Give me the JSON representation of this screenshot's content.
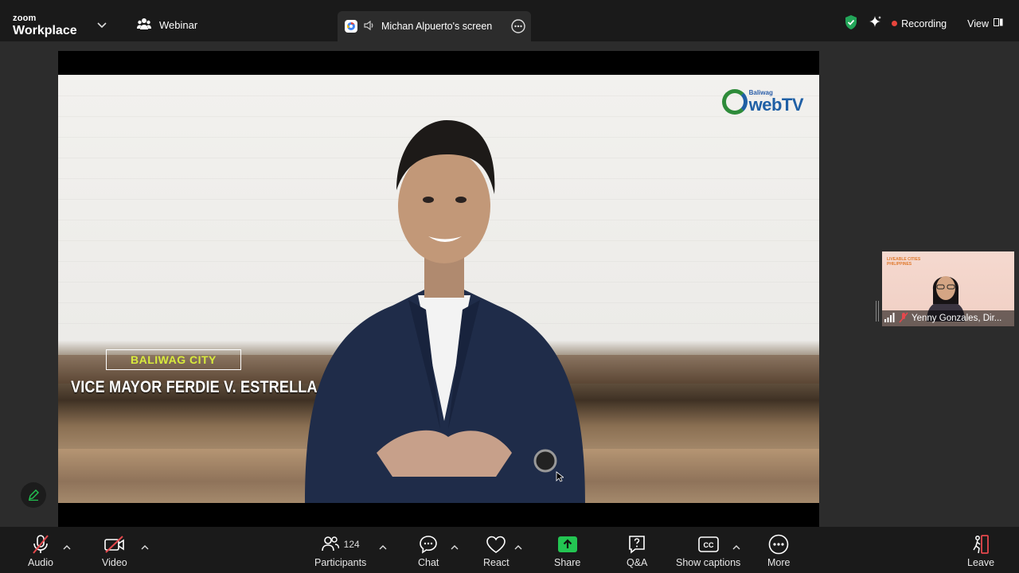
{
  "app": {
    "logo_top": "zoom",
    "logo_bottom": "Workplace"
  },
  "header": {
    "webinar_label": "Webinar",
    "share_tab_title": "Michan Alpuerto's screen",
    "recording_label": "Recording",
    "view_label": "View"
  },
  "shared_content": {
    "watermark_small": "Baliwag",
    "watermark_big": "webTV",
    "lower_third_location": "BALIWAG CITY",
    "lower_third_name": "VICE MAYOR FERDIE V. ESTRELLA"
  },
  "participant_thumbnail": {
    "name": "Yenny Gonzales, Dir...",
    "org_line1": "LIVEABLE CITIES",
    "org_line2": "PHILIPPINES"
  },
  "toolbar": {
    "audio": "Audio",
    "video": "Video",
    "participants": "Participants",
    "participants_count": "124",
    "chat": "Chat",
    "react": "React",
    "share": "Share",
    "qa": "Q&A",
    "captions": "Show captions",
    "more": "More",
    "leave": "Leave"
  },
  "colors": {
    "accent_green": "#23c552",
    "recording_red": "#e8453c",
    "leave_red": "#e5484d",
    "security_green": "#23a559"
  }
}
